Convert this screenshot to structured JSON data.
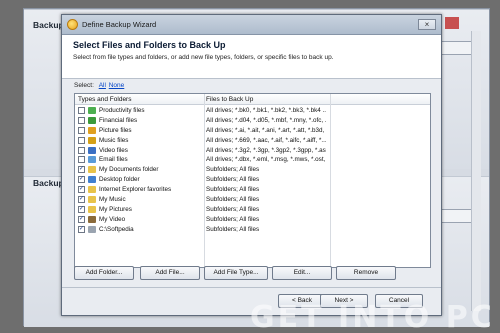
{
  "background_app": {
    "panel1_title": "Backup",
    "panel2_title": "Backup"
  },
  "wizard": {
    "window_title": "Define Backup Wizard",
    "close_glyph": "×",
    "heading": "Select Files and Folders to Back Up",
    "description": "Select from file types and folders, or add new file types, folders, or specific files to back up.",
    "select_label": "Select:",
    "select_all": "All",
    "select_none": "None",
    "columns": {
      "types": "Types and Folders",
      "files": "Files to Back Up"
    },
    "rows": [
      {
        "label": "Productivity files",
        "files": "All drives; *.bk0, *.bk1, *.bk2, *.bk3, *.bk4 ...",
        "checked": false,
        "mark": "",
        "icon": "spreadsheet-icon",
        "color": "#4caf50"
      },
      {
        "label": "Financial files",
        "files": "All drives; *.d04, *.d05, *.mbf, *.mny, *.ofc, ...",
        "checked": false,
        "mark": "",
        "icon": "finance-icon",
        "color": "#3b9a3b"
      },
      {
        "label": "Picture files",
        "files": "All drives; *.ai, *.ait, *.ani, *.art, *.att, *.b3d, ...",
        "checked": false,
        "mark": "",
        "icon": "picture-icon",
        "color": "#e0a020"
      },
      {
        "label": "Music files",
        "files": "All drives; *.669, *.aac, *.aif, *.aifc, *.aiff, *...",
        "checked": false,
        "mark": "",
        "icon": "music-icon",
        "color": "#d4a017"
      },
      {
        "label": "Video files",
        "files": "All drives; *.3g2, *.3gp, *.3gp2, *.3gpp, *.asf, ...",
        "checked": false,
        "mark": "",
        "icon": "video-icon",
        "color": "#3a6fc4"
      },
      {
        "label": "Email files",
        "files": "All drives; *.dbx, *.eml, *.msg, *.mws, *.ost, ...",
        "checked": false,
        "mark": "",
        "icon": "email-icon",
        "color": "#5a9bd8"
      },
      {
        "label": "My Documents folder",
        "files": "Subfolders; All files",
        "checked": true,
        "mark": "✓",
        "icon": "documents-folder-icon",
        "color": "#e8c34a"
      },
      {
        "label": "Desktop folder",
        "files": "Subfolders; All files",
        "checked": true,
        "mark": "✓",
        "icon": "desktop-folder-icon",
        "color": "#3f7fd0"
      },
      {
        "label": "Internet Explorer favorites",
        "files": "Subfolders; All files",
        "checked": true,
        "mark": "✓",
        "icon": "favorites-folder-icon",
        "color": "#e8c34a"
      },
      {
        "label": "My Music",
        "files": "Subfolders; All files",
        "checked": true,
        "mark": "✓",
        "icon": "music-folder-icon",
        "color": "#e8c34a"
      },
      {
        "label": "My Pictures",
        "files": "Subfolders; All files",
        "checked": true,
        "mark": "✓",
        "icon": "pictures-folder-icon",
        "color": "#e8c34a"
      },
      {
        "label": "My Video",
        "files": "Subfolders; All files",
        "checked": true,
        "mark": "✓",
        "icon": "video-folder-icon",
        "color": "#8a6a3a"
      },
      {
        "label": "C:\\Softpedia",
        "files": "Subfolders; All files",
        "checked": true,
        "mark": "✓",
        "icon": "drive-folder-icon",
        "color": "#9aa4b0"
      }
    ],
    "buttons": {
      "add_folder": "Add Folder...",
      "add_file": "Add File...",
      "add_file_type": "Add File Type...",
      "edit": "Edit...",
      "remove": "Remove",
      "back": "< Back",
      "next": "Next >",
      "cancel": "Cancel"
    }
  },
  "watermark": "GET INTO PC"
}
